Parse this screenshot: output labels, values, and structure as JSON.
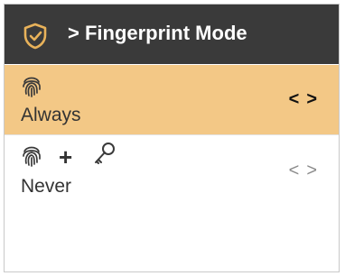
{
  "header": {
    "title": "> Fingerprint Mode",
    "icon": "shield-check-icon",
    "background": "#3a3a3a"
  },
  "options": [
    {
      "label": "Always",
      "icons": [
        "fingerprint-icon"
      ],
      "selected": true,
      "prev_arrow": "<",
      "next_arrow": ">",
      "highlight_color": "#f3c886"
    },
    {
      "label": "Never",
      "icons": [
        "fingerprint-icon",
        "plus-icon",
        "key-icon"
      ],
      "selected": false,
      "prev_arrow": "<",
      "next_arrow": ">"
    }
  ],
  "plus_glyph": "+"
}
